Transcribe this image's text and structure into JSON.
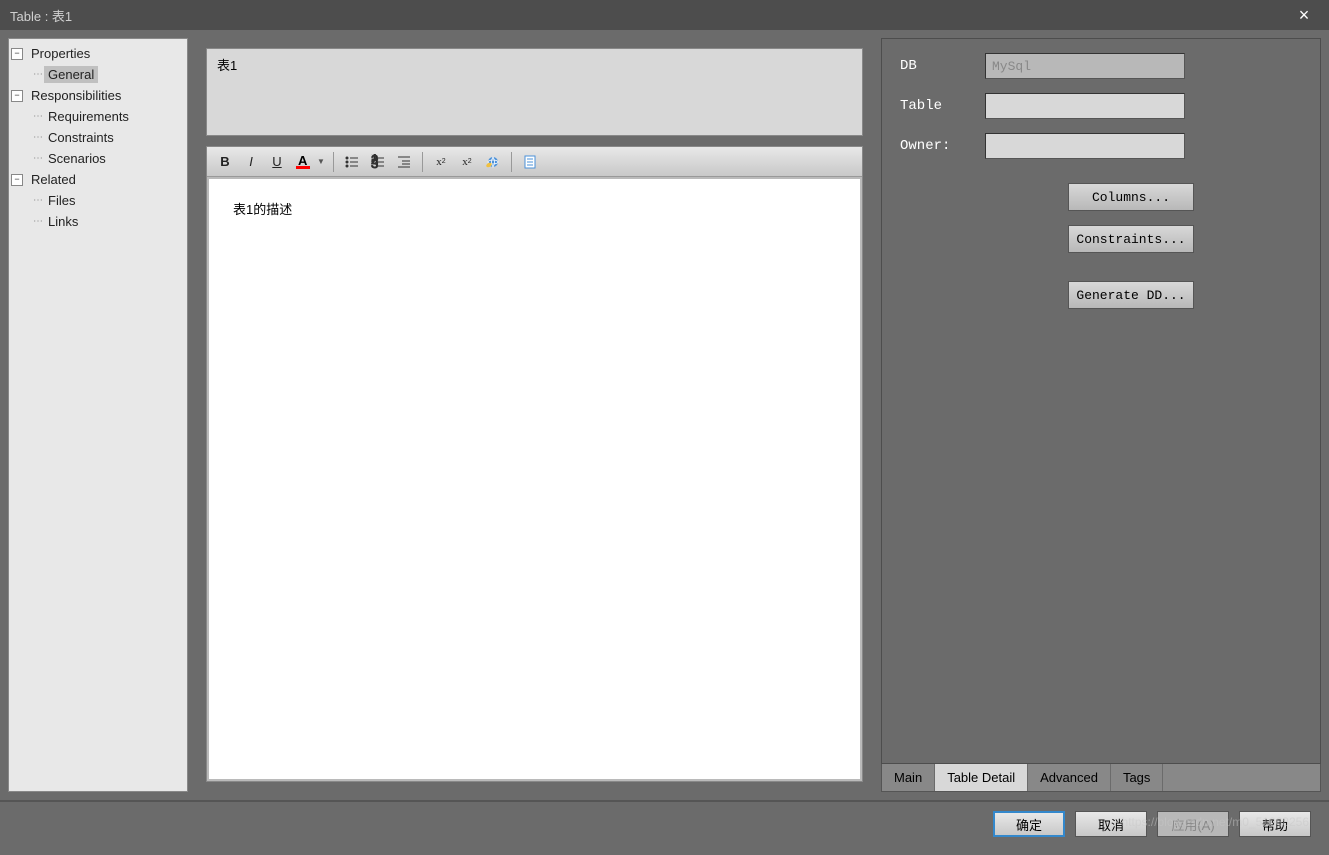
{
  "titlebar": {
    "text": "Table : 表1"
  },
  "sidebar": {
    "properties": {
      "label": "Properties",
      "children": {
        "general": "General"
      }
    },
    "responsibilities": {
      "label": "Responsibilities",
      "children": {
        "requirements": "Requirements",
        "constraints": "Constraints",
        "scenarios": "Scenarios"
      }
    },
    "related": {
      "label": "Related",
      "children": {
        "files": "Files",
        "links": "Links"
      }
    }
  },
  "center": {
    "name_value": "表1",
    "description_text": "表1的描述"
  },
  "toolbar": {
    "bold": "B",
    "italic": "I",
    "underline": "U"
  },
  "details": {
    "db_label": "DB",
    "db_value": "MySql",
    "table_label": "Table",
    "table_value": "",
    "owner_label": "Owner:",
    "owner_value": "",
    "columns_btn": "Columns...",
    "constraints_btn": "Constraints...",
    "generate_btn": "Generate DD..."
  },
  "tabs": {
    "main": "Main",
    "table_detail": "Table Detail",
    "advanced": "Advanced",
    "tags": "Tags"
  },
  "footer": {
    "ok": "确定",
    "cancel": "取消",
    "apply": "应用(A)",
    "help": "帮助"
  },
  "watermark": "https://blog.csdn.net/m0_51068256"
}
